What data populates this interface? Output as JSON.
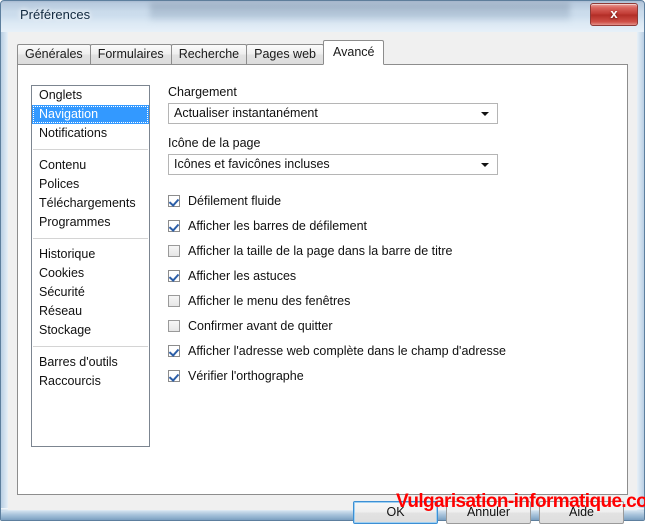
{
  "window": {
    "title": "Préférences",
    "close_label": "x",
    "close_icon": "close-icon",
    "accent_color": "#3399ff",
    "close_button_color": "#c03a33"
  },
  "tabs": [
    {
      "label": "Générales",
      "selected": false
    },
    {
      "label": "Formulaires",
      "selected": false
    },
    {
      "label": "Recherche",
      "selected": false
    },
    {
      "label": "Pages web",
      "selected": false
    },
    {
      "label": "Avancé",
      "selected": true
    }
  ],
  "sidebar": {
    "groups": [
      {
        "items": [
          {
            "label": "Onglets",
            "selected": false
          },
          {
            "label": "Navigation",
            "selected": true
          },
          {
            "label": "Notifications",
            "selected": false
          }
        ]
      },
      {
        "items": [
          {
            "label": "Contenu",
            "selected": false
          },
          {
            "label": "Polices",
            "selected": false
          },
          {
            "label": "Téléchargements",
            "selected": false
          },
          {
            "label": "Programmes",
            "selected": false
          }
        ]
      },
      {
        "items": [
          {
            "label": "Historique",
            "selected": false
          },
          {
            "label": "Cookies",
            "selected": false
          },
          {
            "label": "Sécurité",
            "selected": false
          },
          {
            "label": "Réseau",
            "selected": false
          },
          {
            "label": "Stockage",
            "selected": false
          }
        ]
      },
      {
        "items": [
          {
            "label": "Barres d'outils",
            "selected": false
          },
          {
            "label": "Raccourcis",
            "selected": false
          }
        ]
      }
    ]
  },
  "content": {
    "loading": {
      "label": "Chargement",
      "value": "Actualiser instantanément"
    },
    "page_icon": {
      "label": "Icône de la page",
      "value": "Icônes et favicônes incluses"
    },
    "checkboxes": [
      {
        "label": "Défilement fluide",
        "checked": true
      },
      {
        "label": "Afficher les barres de défilement",
        "checked": true
      },
      {
        "label": "Afficher la taille de la page dans la barre de titre",
        "checked": false
      },
      {
        "label": "Afficher les astuces",
        "checked": true
      },
      {
        "label": "Afficher le menu des fenêtres",
        "checked": false
      },
      {
        "label": "Confirmer avant de quitter",
        "checked": false
      },
      {
        "label": "Afficher l'adresse web complète dans le champ d'adresse",
        "checked": true
      },
      {
        "label": "Vérifier l'orthographe",
        "checked": true
      }
    ]
  },
  "buttons": {
    "ok": "OK",
    "cancel": "Annuler",
    "help": "Aide"
  },
  "watermark": {
    "text": "Vulgarisation-informatique.com",
    "color": "#ff0000"
  }
}
